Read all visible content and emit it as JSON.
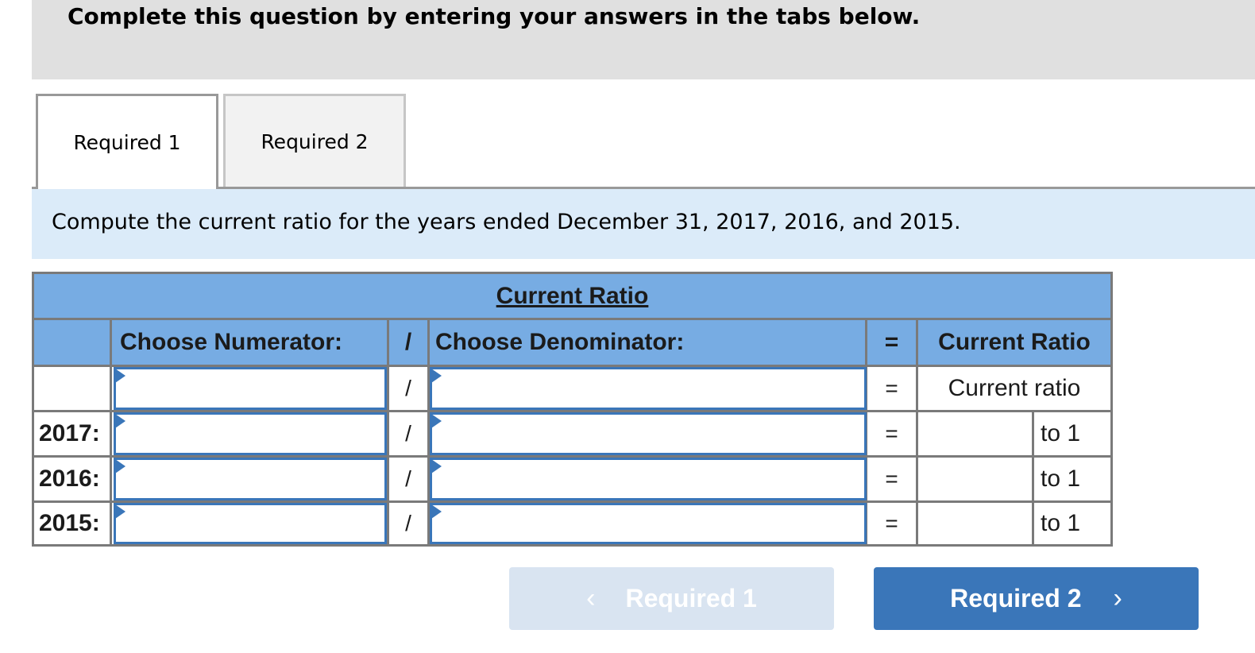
{
  "instruction": "Complete this question by entering your answers in the tabs below.",
  "tabs": [
    {
      "label": "Required 1",
      "active": true
    },
    {
      "label": "Required 2",
      "active": false
    }
  ],
  "prompt": "Compute the current ratio for the years ended December 31, 2017, 2016, and 2015.",
  "table": {
    "title": "Current Ratio",
    "headers": {
      "numerator": "Choose Numerator:",
      "divide": "/",
      "denominator": "Choose Denominator:",
      "equals": "=",
      "result": "Current Ratio"
    },
    "formula_row": {
      "label": "",
      "numerator": "",
      "divide": "/",
      "denominator": "",
      "equals": "=",
      "result": "Current ratio"
    },
    "rows": [
      {
        "label": "2017:",
        "numerator": "",
        "divide": "/",
        "denominator": "",
        "equals": "=",
        "value": "",
        "suffix": "to 1"
      },
      {
        "label": "2016:",
        "numerator": "",
        "divide": "/",
        "denominator": "",
        "equals": "=",
        "value": "",
        "suffix": "to 1"
      },
      {
        "label": "2015:",
        "numerator": "",
        "divide": "/",
        "denominator": "",
        "equals": "=",
        "value": "",
        "suffix": "to 1"
      }
    ]
  },
  "nav": {
    "prev_label": "Required 1",
    "prev_icon": "chevron-left-icon",
    "prev_glyph": "‹",
    "next_label": "Required 2",
    "next_icon": "chevron-right-icon",
    "next_glyph": "›"
  },
  "colors": {
    "header_blue": "#77ace3",
    "input_border": "#3a76b9",
    "prompt_bg": "#dbebf9",
    "next_button": "#3a76b9",
    "prev_button_disabled": "#d9e4f1"
  }
}
